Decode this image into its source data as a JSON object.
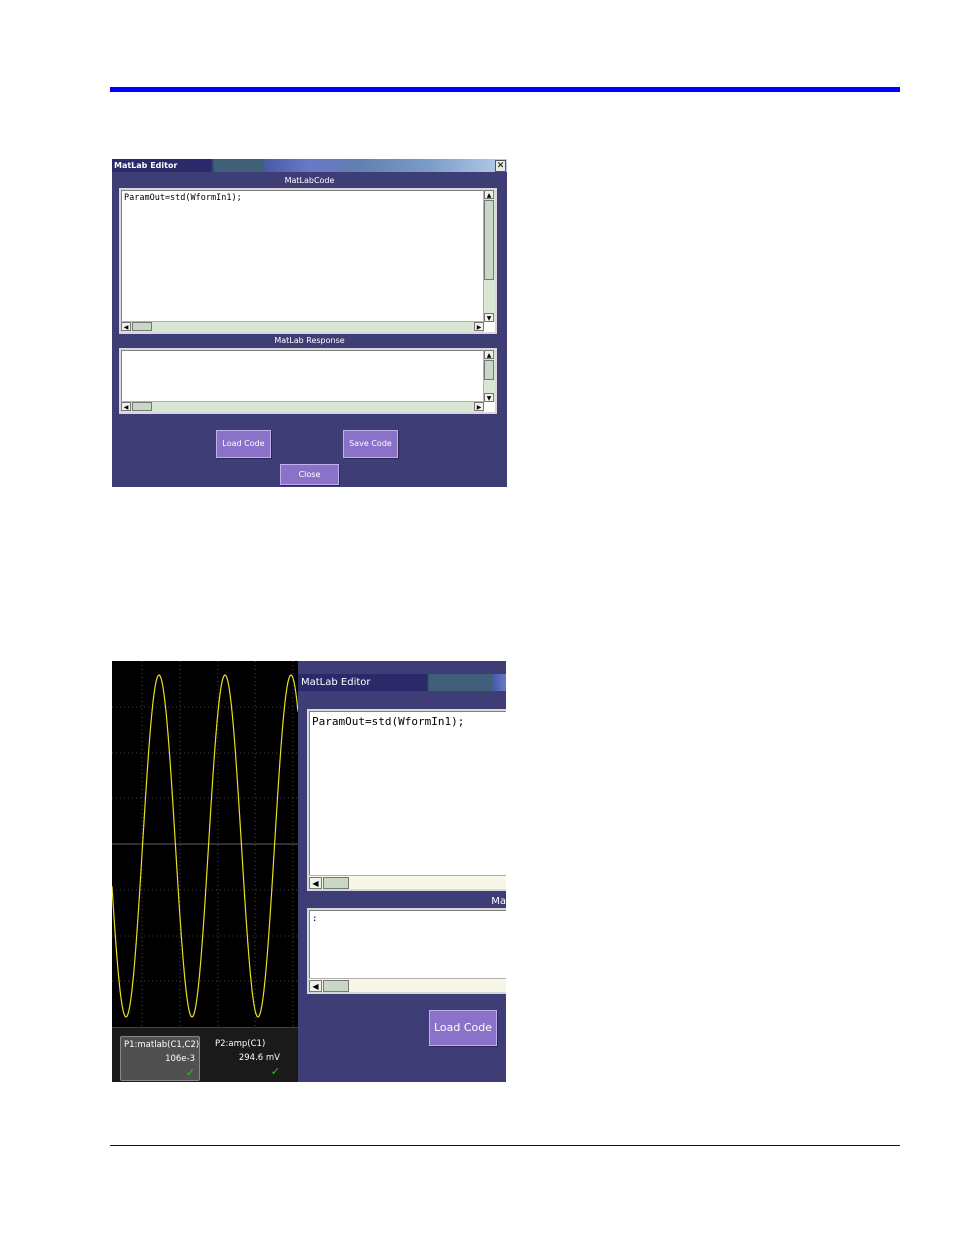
{
  "figure1": {
    "window_title": "MatLab Editor",
    "close_glyph": "✕",
    "code_label": "MatLabCode",
    "code_text": "ParamOut=std(WformIn1);",
    "response_label": "MatLab Response",
    "response_text": "",
    "load_button": "Load Code",
    "save_button": "Save Code",
    "close_button": "Close",
    "colors": {
      "window_bg": "#3f3d75",
      "button_bg": "#8a72c8",
      "scroll_track": "#d9e6d3"
    }
  },
  "figure2": {
    "measurements": [
      {
        "name": "P1:matlab(C1,C2)",
        "value": "106e-3"
      },
      {
        "name": "P2:amp(C1)",
        "value": "294.6 mV"
      }
    ],
    "check_glyph": "✓",
    "window_title": "MatLab Editor",
    "code_text": "ParamOut=std(WformIn1);",
    "response_text": ":",
    "response_label_partial": "Ma",
    "load_button": "Load Code",
    "colors": {
      "trace": "#e8e020",
      "screen_bg": "#000000",
      "grid": "#808080"
    }
  },
  "icons": {
    "scroll_up": "▲",
    "scroll_down": "▼",
    "scroll_left": "◀",
    "scroll_right": "▶"
  }
}
